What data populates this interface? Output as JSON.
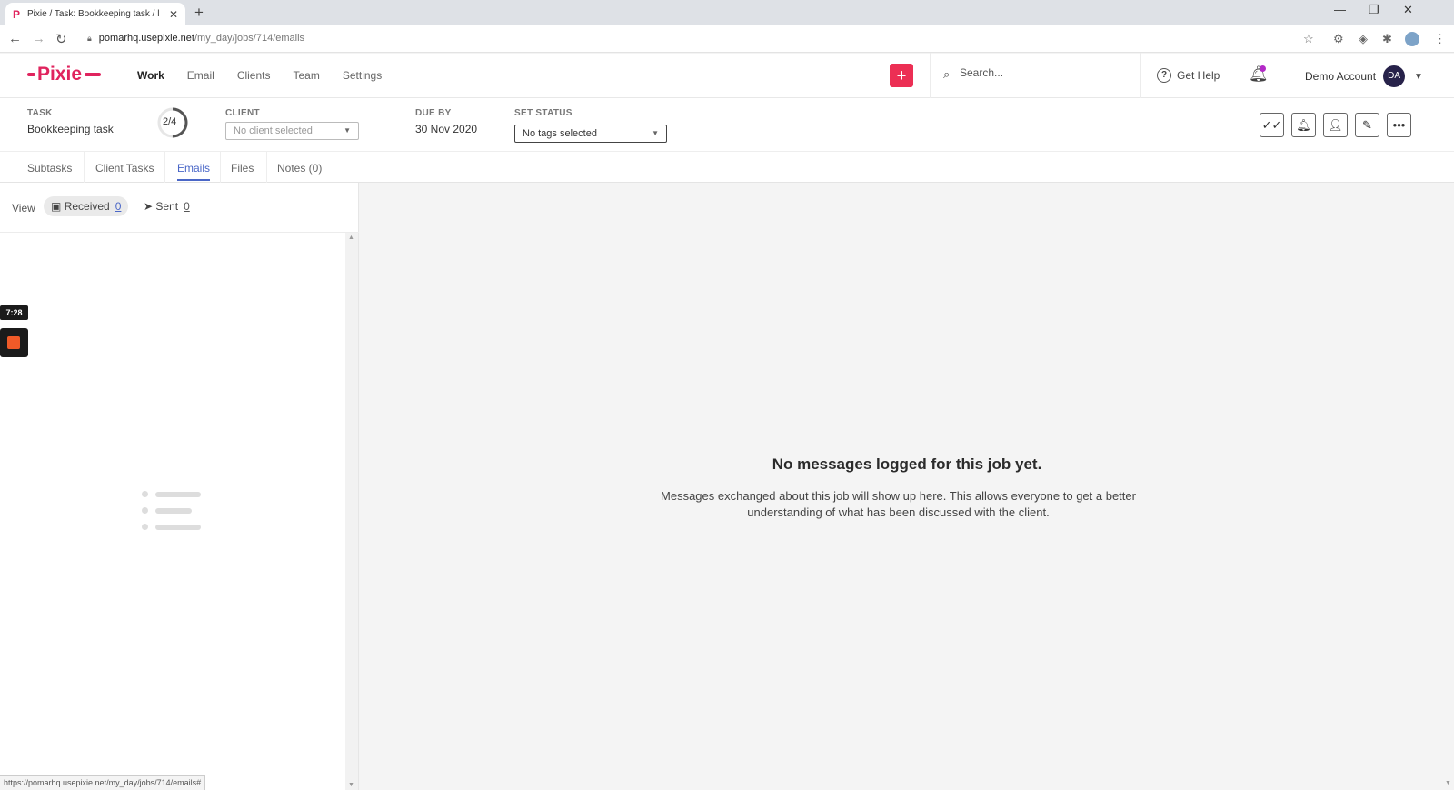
{
  "browser": {
    "tab_title": "Pixie / Task: Bookkeeping task / l",
    "favicon": "P",
    "url_host": "pomarhq.usepixie.net",
    "url_path": "/my_day/jobs/714/emails",
    "status_url": "https://pomarhq.usepixie.net/my_day/jobs/714/emails#"
  },
  "app": {
    "brand": "Pixie",
    "brand_color": "#e0245e",
    "nav": [
      "Work",
      "Email",
      "Clients",
      "Team",
      "Settings"
    ],
    "plus": "+",
    "search_placeholder": "Search...",
    "help": "Get Help",
    "help_glyph": "?",
    "account_name": "Demo Account",
    "account_initials": "DA"
  },
  "task": {
    "task_label": "TASK",
    "task_value": "Bookkeeping task",
    "progress_text": "2/4",
    "progress_fraction": 0.5,
    "client_label": "CLIENT",
    "client_value": "No client selected",
    "due_label": "DUE BY",
    "due_value": "30 Nov 2020",
    "status_label": "SET STATUS",
    "status_value": "No tags selected"
  },
  "tabs": [
    "Subtasks",
    "Client Tasks",
    "Emails",
    "Files",
    "Notes (0)"
  ],
  "emails": {
    "view_label": "View",
    "received_label": "Received",
    "received_count": "0",
    "sent_label": "Sent",
    "sent_count": "0"
  },
  "recorder": {
    "time": "7:28"
  },
  "empty_state": {
    "title": "No messages logged for this job yet.",
    "text": "Messages exchanged about this job will show up here. This allows everyone to get a better understanding of what has been discussed with the client."
  }
}
